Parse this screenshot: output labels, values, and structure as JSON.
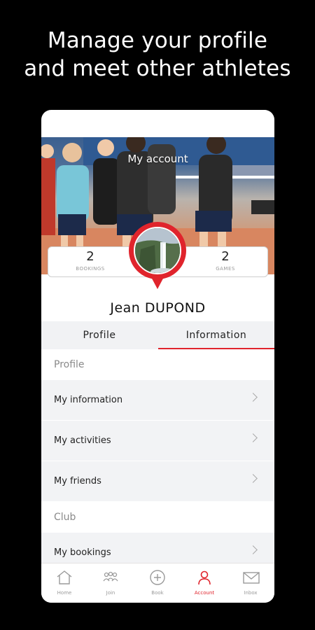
{
  "headline": {
    "line1": "Manage your profile",
    "line2": "and meet other athletes"
  },
  "screen": {
    "title": "My account"
  },
  "stats": {
    "bookings_value": "2",
    "bookings_label": "BOOKINGS",
    "games_value": "2",
    "games_label": "GAMES"
  },
  "user": {
    "name": "Jean  DUPOND"
  },
  "tabs": [
    {
      "label": "Profile",
      "active": false
    },
    {
      "label": "Information",
      "active": true
    }
  ],
  "sections": [
    {
      "title": "Profile",
      "items": [
        "My information",
        "My activities",
        "My friends"
      ]
    },
    {
      "title": "Club",
      "items": [
        "My bookings"
      ]
    }
  ],
  "nav": [
    {
      "label": "Home",
      "icon": "home-icon"
    },
    {
      "label": "Join",
      "icon": "group-icon"
    },
    {
      "label": "Book",
      "icon": "plus-circle-icon"
    },
    {
      "label": "Account",
      "icon": "user-icon",
      "active": true
    },
    {
      "label": "Inbox",
      "icon": "mail-icon"
    }
  ],
  "colors": {
    "accent": "#e0242c",
    "background": "#000000",
    "list_background": "#f2f3f5"
  }
}
